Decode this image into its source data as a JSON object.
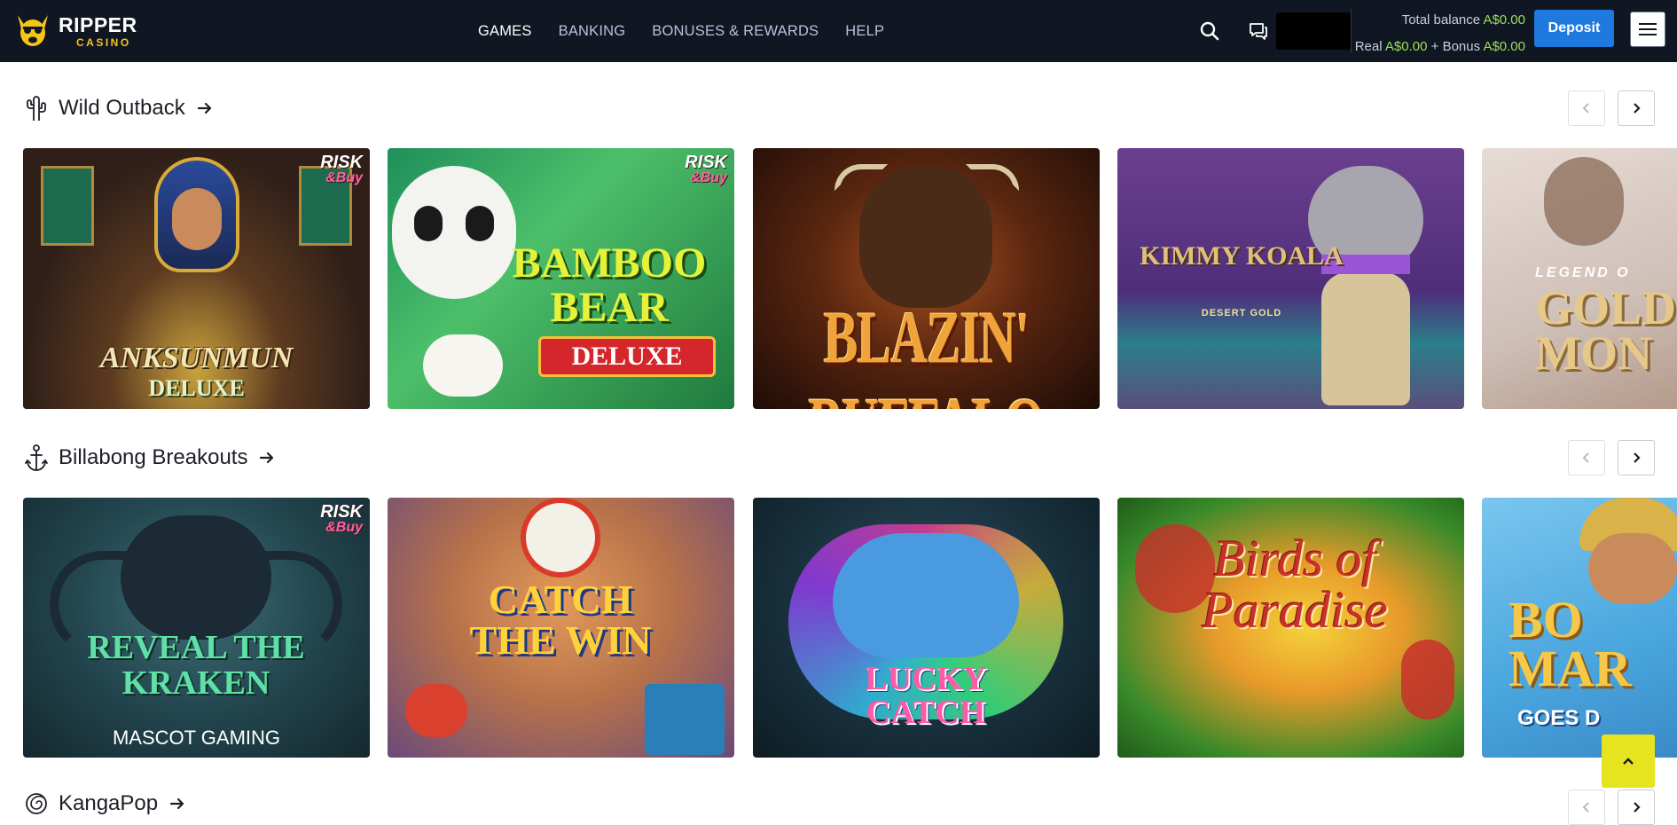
{
  "brand": {
    "title": "RIPPER",
    "subtitle": "CASINO"
  },
  "nav": [
    {
      "label": "GAMES",
      "active": true
    },
    {
      "label": "BANKING",
      "active": false
    },
    {
      "label": "BONUSES & REWARDS",
      "active": false
    },
    {
      "label": "HELP",
      "active": false
    }
  ],
  "balance": {
    "total_label": "Total balance",
    "total_value": "A$0.00",
    "real_label": "Real",
    "real_value": "A$0.00",
    "plus": "+",
    "bonus_label": "Bonus",
    "bonus_value": "A$0.00"
  },
  "deposit_label": "Deposit",
  "icons": {
    "search": "search-icon",
    "chat": "chat-icon",
    "menu": "hamburger-menu-icon",
    "scroll_top": "chevron-up-icon"
  },
  "sections": [
    {
      "title": "Wild Outback",
      "icon": "cactus-icon",
      "games": [
        {
          "name": "ANKSUNMUN",
          "sub": "DELUXE",
          "badge": [
            "RISK",
            "&Buy"
          ]
        },
        {
          "name": "BAMBOO BEAR",
          "sub": "DELUXE",
          "badge": [
            "RISK",
            "&Buy"
          ]
        },
        {
          "name": "BLAZIN' BUFFALO",
          "sub": ""
        },
        {
          "name": "KIMMY KOALA",
          "sub": "DESERT GOLD"
        },
        {
          "name": "GOLD MON",
          "sub": "LEGEND O"
        }
      ]
    },
    {
      "title": "Billabong Breakouts",
      "icon": "anchor-icon",
      "games": [
        {
          "name": "REVEAL THE KRAKEN",
          "sub": "MASCOT GAMING",
          "badge": [
            "RISK",
            "&Buy"
          ]
        },
        {
          "name": "CATCH THE WIN",
          "sub": ""
        },
        {
          "name": "LUCKY CATCH",
          "sub": ""
        },
        {
          "name": "Birds of Paradise",
          "sub": ""
        },
        {
          "name": "BO MAR",
          "sub": "GOES D"
        }
      ]
    },
    {
      "title": "KangaPop",
      "icon": "spiral-icon",
      "games": []
    }
  ],
  "colors": {
    "header_bg": "#101622",
    "accent_blue": "#1f7ae0",
    "balance_green": "#9be15d",
    "scroll_top_bg": "#e6e41e"
  }
}
